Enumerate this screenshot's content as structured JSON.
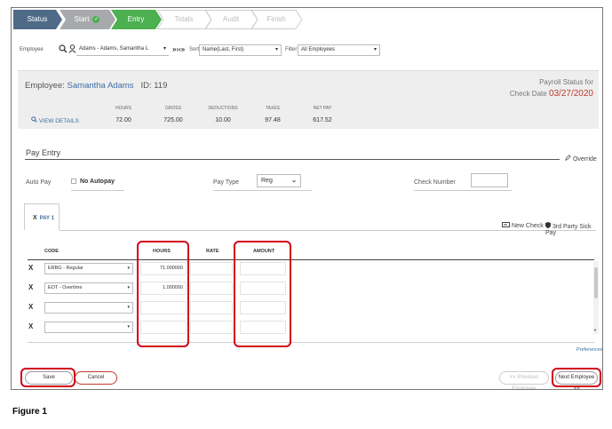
{
  "steps": [
    {
      "label": "Status",
      "state": "done-dark"
    },
    {
      "label": "Start",
      "state": "done-gray",
      "check": "✓"
    },
    {
      "label": "Entry",
      "state": "active"
    },
    {
      "label": "Totals",
      "state": "future"
    },
    {
      "label": "Audit",
      "state": "future"
    },
    {
      "label": "Finish",
      "state": "future"
    }
  ],
  "filter": {
    "employee_label": "Employee",
    "employee_value": "Adams - Adams, Samantha L",
    "nav_glyph": "»›‹»",
    "sort_label": "Sort",
    "sort_value": "Name(Last, First)",
    "filter_label": "Filter",
    "filter_value": "All Employees"
  },
  "summary": {
    "employee_prefix": "Employee:",
    "employee_name": "Samantha Adams",
    "id_label": "ID: 119",
    "status_line1": "Payroll Status for",
    "status_line2_prefix": "Check Date",
    "check_date": "03/27/2020",
    "view_details": "VIEW DETAILS",
    "headers": [
      "HOURS",
      "GROSS",
      "DEDUCTIONS",
      "TAXES",
      "NET PAY"
    ],
    "values": [
      "72.00",
      "725.00",
      "10.00",
      "97.48",
      "617.52"
    ]
  },
  "pay_entry": {
    "title": "Pay Entry",
    "override": "Override",
    "auto_pay_label": "Auto Pay",
    "no_autopay": "No Autopay",
    "pay_type_label": "Pay Type",
    "pay_type_value": "Reg",
    "check_number_label": "Check Number"
  },
  "tab": {
    "close": "X",
    "label": "PAY 1",
    "new_check": "New Check",
    "third_party": "3rd Party Sick Pay"
  },
  "grid": {
    "columns": {
      "code": "CODE",
      "hours": "HOURS",
      "rate": "RATE",
      "amount": "AMOUNT"
    },
    "rows": [
      {
        "x": "X",
        "code": "ERBG - Regular",
        "hours": "71.000000",
        "rate": "",
        "amount": ""
      },
      {
        "x": "X",
        "code": "EOT - Overtime",
        "hours": "1.000000",
        "rate": "",
        "amount": ""
      },
      {
        "x": "X",
        "code": "",
        "hours": "",
        "rate": "",
        "amount": ""
      },
      {
        "x": "X",
        "code": "",
        "hours": "",
        "rate": "",
        "amount": ""
      }
    ],
    "preferences": "Preferences"
  },
  "footer": {
    "save": "Save",
    "cancel": "Cancel",
    "previous": "<< Previous Employee",
    "next": "Next Employee >>"
  },
  "caption": "Figure 1",
  "colors": {
    "step_dark": "#4e6a87",
    "step_gray": "#a7a9ac",
    "step_active": "#4caf50",
    "link": "#3a6ea5",
    "date_red": "#c0392b",
    "highlight": "#d0021b"
  },
  "icons": {
    "search": "search-icon",
    "person": "person-icon",
    "override": "pencil-icon",
    "new_check": "new-check-icon",
    "third_party": "shield-icon"
  }
}
